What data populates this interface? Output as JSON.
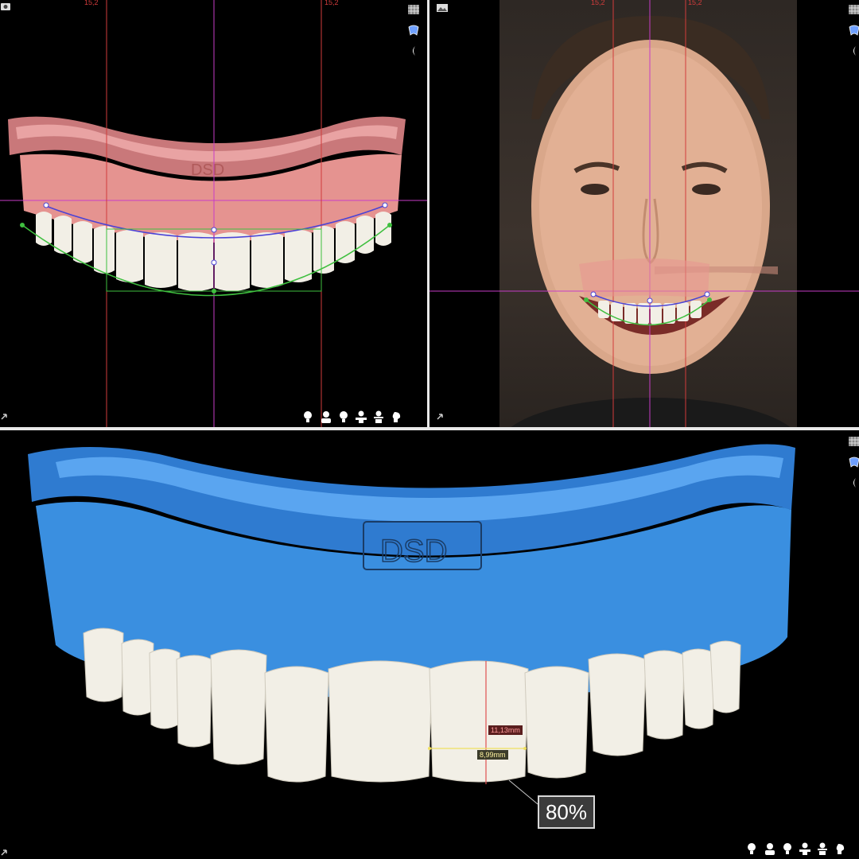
{
  "colors": {
    "guide_red": "#d13b3b",
    "guide_magenta": "#c63cc6",
    "curve_blue": "#4a43d6",
    "curve_green": "#3fbf3f",
    "mockup_pink": "#e7968f",
    "mockup_blue": "#3a8fe0",
    "teeth_white": "#f2efe6",
    "separator": "#e8e8e8"
  },
  "top_left": {
    "guide_label_left": "15,2",
    "guide_label_right": "15,2",
    "model_brand_text": "DSD"
  },
  "top_right": {
    "guide_label_left": "15,2",
    "guide_label_right": "15,2"
  },
  "bottom": {
    "model_brand_text": "DSD",
    "measure_length": "11,13mm",
    "measure_width": "8,99mm",
    "ratio_badge": "80%"
  },
  "toolbar_icons": [
    "camera-icon",
    "mesh-icon",
    "tooth-model-icon",
    "lip-icon"
  ],
  "view_icons": [
    "front-view-icon",
    "head-view-icon",
    "side-view-icon",
    "bust-view-icon",
    "torso-view-icon",
    "profile-view-icon"
  ]
}
